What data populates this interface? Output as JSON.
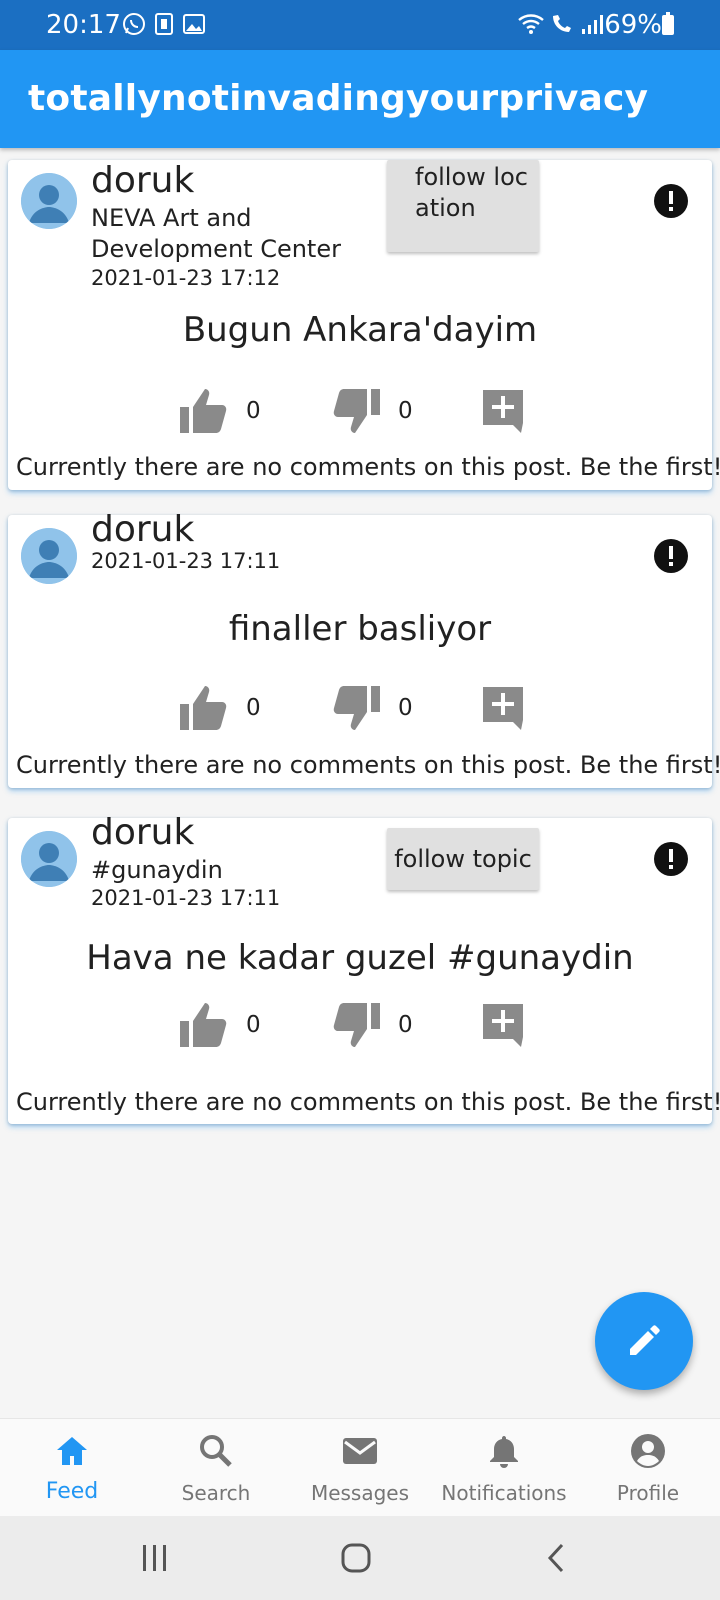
{
  "status_bar": {
    "time": "20:17",
    "battery": "69%",
    "left_icons": [
      "whatsapp-icon",
      "sim-icon",
      "gallery-icon"
    ],
    "right_icons": [
      "wifi-icon",
      "wifi-call-icon",
      "signal-icon",
      "battery-icon"
    ]
  },
  "app": {
    "title": "totallynotinvadingyourprivacy",
    "colors": {
      "primary": "#2196f3",
      "status_bar": "#1b6fc2",
      "button_grey": "#e0e0e0",
      "icon_grey": "#8a8a8a"
    }
  },
  "posts": [
    {
      "username": "doruk",
      "location": "NEVA Art and Development Center",
      "timestamp": "2021-01-23 17:12",
      "follow_button": "follow location",
      "text": "Bugun Ankara'dayim",
      "likes": "0",
      "dislikes": "0",
      "comments": "Currently there are no comments on this post. Be the first!"
    },
    {
      "username": "doruk",
      "timestamp": "2021-01-23 17:11",
      "text": "finaller basliyor",
      "likes": "0",
      "dislikes": "0",
      "comments": "Currently there are no comments on this post. Be the first!"
    },
    {
      "username": "doruk",
      "topic": "#gunaydin",
      "timestamp": "2021-01-23 17:11",
      "follow_button": "follow topic",
      "text": "Hava ne kadar guzel #gunaydin",
      "likes": "0",
      "dislikes": "0",
      "comments": "Currently there are no comments on this post. Be the first!"
    }
  ],
  "fab": {
    "icon": "pencil-icon"
  },
  "bottom_nav": [
    {
      "label": "Feed",
      "icon": "home-icon",
      "active": true
    },
    {
      "label": "Search",
      "icon": "search-icon",
      "active": false
    },
    {
      "label": "Messages",
      "icon": "mail-icon",
      "active": false
    },
    {
      "label": "Notifications",
      "icon": "bell-icon",
      "active": false
    },
    {
      "label": "Profile",
      "icon": "account-icon",
      "active": false
    }
  ],
  "system_nav": [
    "recents-button",
    "home-button",
    "back-button"
  ]
}
